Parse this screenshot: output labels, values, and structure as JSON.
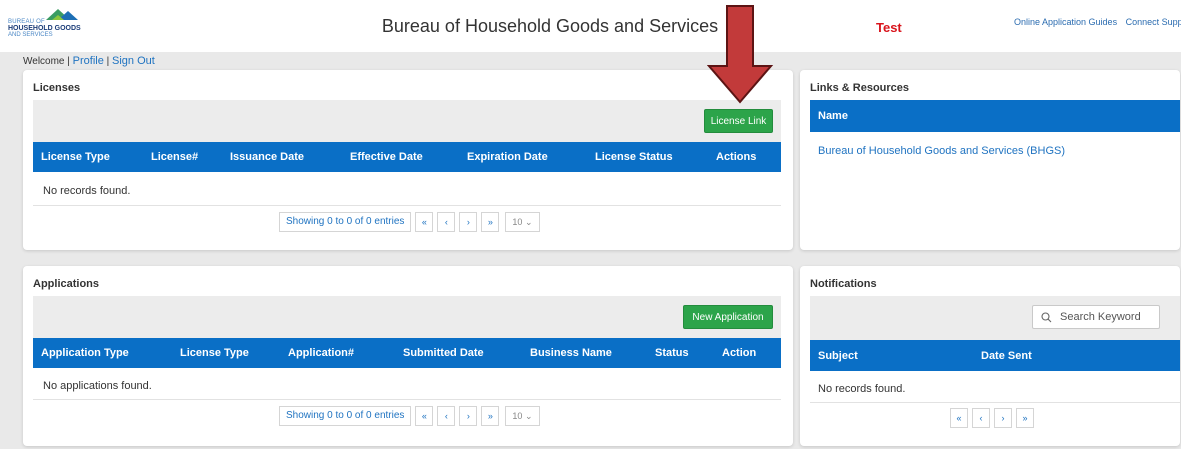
{
  "header": {
    "logo": {
      "line1": "BUREAU OF",
      "line2": "HOUSEHOLD GOODS",
      "line3": "AND SERVICES"
    },
    "title": "Bureau of Household Goods and Services",
    "environment": "Test",
    "links": [
      "Online Application Guides",
      "Connect Suppo"
    ],
    "welcome_text": "Welcome |",
    "profile": "Profile",
    "separator": "|",
    "sign_out": "Sign Out"
  },
  "colors": {
    "table_header": "#0a6fc6",
    "button_green": "#2ca44a",
    "env_red": "#d9141c",
    "arrow": "#c23a3a"
  },
  "licenses": {
    "title": "Licenses",
    "button": "License Link",
    "columns": [
      "License Type",
      "License#",
      "Issuance Date",
      "Effective Date",
      "Expiration Date",
      "License Status",
      "Actions"
    ],
    "empty": "No records found.",
    "pager": {
      "info": "Showing 0 to 0 of 0 entries",
      "first": "«",
      "prev": "‹",
      "next": "›",
      "last": "»",
      "page_size": "10"
    }
  },
  "applications": {
    "title": "Applications",
    "button": "New Application",
    "columns": [
      "Application Type",
      "License Type",
      "Application#",
      "Submitted Date",
      "Business Name",
      "Status",
      "Action"
    ],
    "empty": "No applications found.",
    "pager": {
      "info": "Showing 0 to 0 of 0 entries",
      "first": "«",
      "prev": "‹",
      "next": "›",
      "last": "»",
      "page_size": "10"
    }
  },
  "links_resources": {
    "title": "Links & Resources",
    "column": "Name",
    "items": [
      "Bureau of Household Goods and Services (BHGS)"
    ]
  },
  "notifications": {
    "title": "Notifications",
    "search_placeholder": "Search Keyword",
    "columns": [
      "Subject",
      "Date Sent"
    ],
    "empty": "No records found.",
    "pager": {
      "first": "«",
      "prev": "‹",
      "next": "›",
      "last": "»"
    }
  }
}
